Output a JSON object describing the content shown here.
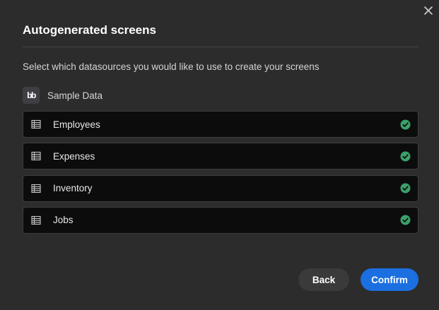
{
  "modal": {
    "title": "Autogenerated screens",
    "subtitle": "Select which datasources you would like to use to create your screens",
    "close_icon": "close-icon"
  },
  "datasource": {
    "logo_text": "bb",
    "label": "Sample Data"
  },
  "tables": [
    {
      "label": "Employees",
      "icon": "table-icon",
      "selected": true
    },
    {
      "label": "Expenses",
      "icon": "table-icon",
      "selected": true
    },
    {
      "label": "Inventory",
      "icon": "table-icon",
      "selected": true
    },
    {
      "label": "Jobs",
      "icon": "table-icon",
      "selected": true
    }
  ],
  "buttons": {
    "back_label": "Back",
    "confirm_label": "Confirm"
  },
  "colors": {
    "background": "#2c2c2c",
    "row_background": "#0c0c0c",
    "check": "#3ba06a",
    "confirm": "#1b6fe0",
    "back": "#3a3a3a"
  }
}
